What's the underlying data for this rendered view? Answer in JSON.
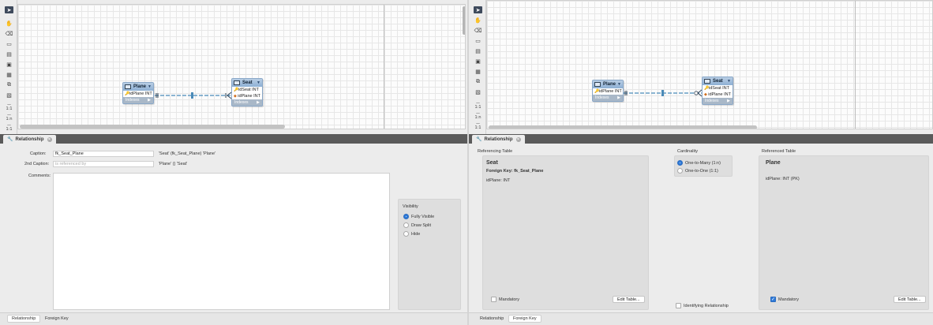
{
  "tables": {
    "plane": {
      "name": "Plane",
      "columns": [
        {
          "key": "pk",
          "text": "idPlane INT"
        }
      ],
      "footer": "Indexes"
    },
    "seat": {
      "name": "Seat",
      "columns": [
        {
          "key": "pk",
          "text": "idSeat INT"
        },
        {
          "key": "fk",
          "text": "idPlane INT"
        }
      ],
      "footer": "Indexes"
    }
  },
  "toolbar": {
    "notation_labels": [
      "1:1",
      "1:n",
      "1:1"
    ]
  },
  "panel": {
    "title": "Relationship"
  },
  "left": {
    "caption_label": "Caption:",
    "caption_value": "fk_Seat_Plane",
    "caption_preview": "'Seat' (fk_Seat_Plane) 'Plane'",
    "caption2_label": "2nd Caption:",
    "caption2_placeholder": "is referenced by",
    "caption2_preview": "'Plane' () 'Seat'",
    "comments_label": "Comments:",
    "visibility": {
      "title": "Visibility",
      "options": [
        {
          "label": "Fully Visible",
          "selected": true
        },
        {
          "label": "Draw Split",
          "selected": false
        },
        {
          "label": "Hide",
          "selected": false
        }
      ]
    },
    "bottom_tabs": [
      {
        "label": "Relationship",
        "active": true
      },
      {
        "label": "Foreign Key",
        "active": false
      }
    ]
  },
  "right": {
    "referencing": {
      "title": "Referencing Table",
      "table": "Seat",
      "fk": "Foreign Key: fk_Seat_Plane",
      "column": "idPlane: INT",
      "mandatory_label": "Mandatory",
      "mandatory": false,
      "edit_label": "Edit Table..."
    },
    "cardinality": {
      "title": "Cardinality",
      "options": [
        {
          "label": "One-to-Many (1:n)",
          "selected": true
        },
        {
          "label": "One-to-One (1:1)",
          "selected": false
        }
      ],
      "identifying_label": "Identifying Relationship",
      "identifying": false
    },
    "referenced": {
      "title": "Referenced Table",
      "table": "Plane",
      "column": "idPlane: INT (PK)",
      "mandatory_label": "Mandatory",
      "mandatory": true,
      "edit_label": "Edit Table..."
    },
    "bottom_tabs": [
      {
        "label": "Relationship",
        "active": false
      },
      {
        "label": "Foreign Key",
        "active": true
      }
    ]
  },
  "colors": {
    "accent": "#2f7ad8",
    "table_header": "#8eb0d4",
    "connector": "#4a8ab8"
  }
}
